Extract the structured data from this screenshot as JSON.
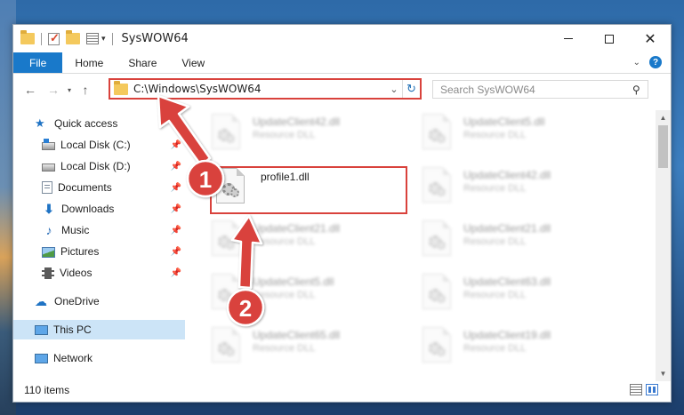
{
  "window": {
    "title": "SysWOW64"
  },
  "ribbon": {
    "tabs": [
      "File",
      "Home",
      "Share",
      "View"
    ],
    "help_label": "?"
  },
  "address": {
    "path": "C:\\Windows\\SysWOW64",
    "refresh_glyph": "↻"
  },
  "search": {
    "placeholder": "Search SysWOW64"
  },
  "nav_pane": {
    "items": [
      {
        "label": "Quick access",
        "icon": "star-icon"
      },
      {
        "label": "Local Disk (C:)",
        "icon": "drive-icon",
        "pinned": true
      },
      {
        "label": "Local Disk (D:)",
        "icon": "drive-icon",
        "pinned": true
      },
      {
        "label": "Documents",
        "icon": "documents-icon",
        "pinned": true
      },
      {
        "label": "Downloads",
        "icon": "download-icon",
        "pinned": true
      },
      {
        "label": "Music",
        "icon": "music-icon",
        "pinned": true
      },
      {
        "label": "Pictures",
        "icon": "pictures-icon",
        "pinned": true
      },
      {
        "label": "Videos",
        "icon": "videos-icon",
        "pinned": true
      },
      {
        "label": "OneDrive",
        "icon": "cloud-icon"
      },
      {
        "label": "This PC",
        "icon": "computer-icon",
        "selected": true
      },
      {
        "label": "Network",
        "icon": "network-icon"
      }
    ]
  },
  "files": {
    "col1": [
      {
        "name": "UpdateClient42.dll",
        "type": "Resource DLL"
      },
      {
        "name": "UpdateClient21.dll",
        "type": "Resource DLL"
      },
      {
        "name": "UpdateClient5.dll",
        "type": "Resource DLL"
      },
      {
        "name": "UpdateClient65.dll",
        "type": "Resource DLL"
      }
    ],
    "col2": [
      {
        "name": "UpdateClient5.dll",
        "type": "Resource DLL"
      },
      {
        "name": "UpdateClient42.dll",
        "type": "Resource DLL"
      },
      {
        "name": "UpdateClient21.dll",
        "type": "Resource DLL"
      },
      {
        "name": "UpdateClient63.dll",
        "type": "Resource DLL"
      },
      {
        "name": "UpdateClient19.dll",
        "type": "Resource DLL"
      }
    ],
    "highlighted": {
      "name": "profile1.dll"
    }
  },
  "status": {
    "item_count": "110 items"
  },
  "annotations": {
    "step1": "1",
    "step2": "2",
    "color": "#d9423c"
  }
}
